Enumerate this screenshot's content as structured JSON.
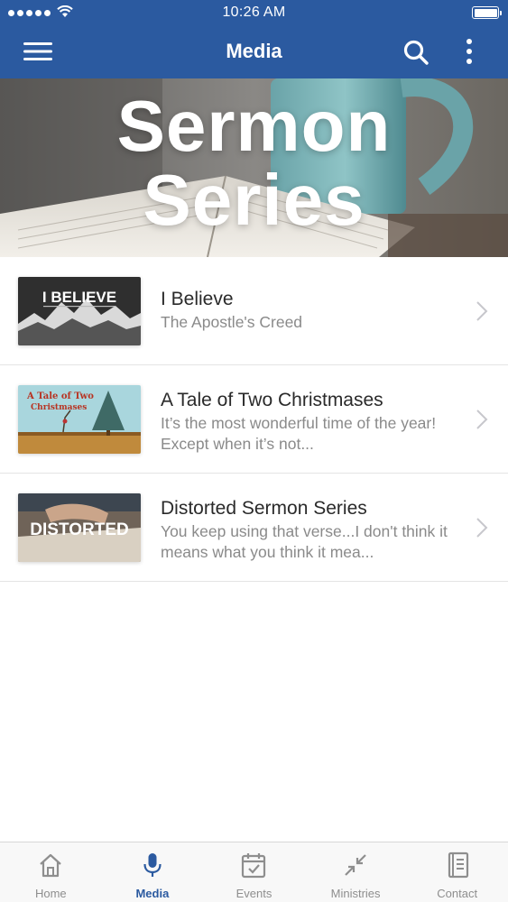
{
  "status_bar": {
    "time": "10:26 AM"
  },
  "nav": {
    "title": "Media",
    "menu_icon": "hamburger-menu-icon",
    "search_icon": "search-icon",
    "more_icon": "more-vertical-icon"
  },
  "hero": {
    "title_line1": "Sermon",
    "title_line2": "Series"
  },
  "series": [
    {
      "title": "I Believe",
      "subtitle": "The Apostle's Creed",
      "thumb_text": "I BELIEVE"
    },
    {
      "title": "A Tale of Two Christmases",
      "subtitle": "It’s the most wonderful time of the year! Except when it’s not...",
      "thumb_text_line1": "A Tale of Two",
      "thumb_text_line2": "Christmases"
    },
    {
      "title": "Distorted Sermon Series",
      "subtitle": "You keep using that verse...I don't think it means what you think it mea...",
      "thumb_text": "DISTORTED"
    }
  ],
  "tabs": [
    {
      "label": "Home",
      "icon": "home-icon",
      "active": false
    },
    {
      "label": "Media",
      "icon": "microphone-icon",
      "active": true
    },
    {
      "label": "Events",
      "icon": "calendar-icon",
      "active": false
    },
    {
      "label": "Ministries",
      "icon": "arrows-inward-icon",
      "active": false
    },
    {
      "label": "Contact",
      "icon": "contact-book-icon",
      "active": false
    }
  ],
  "colors": {
    "brand_blue": "#2b5aa0",
    "tab_inactive": "#8e8e8e",
    "subtitle_gray": "#8a8a8a"
  }
}
